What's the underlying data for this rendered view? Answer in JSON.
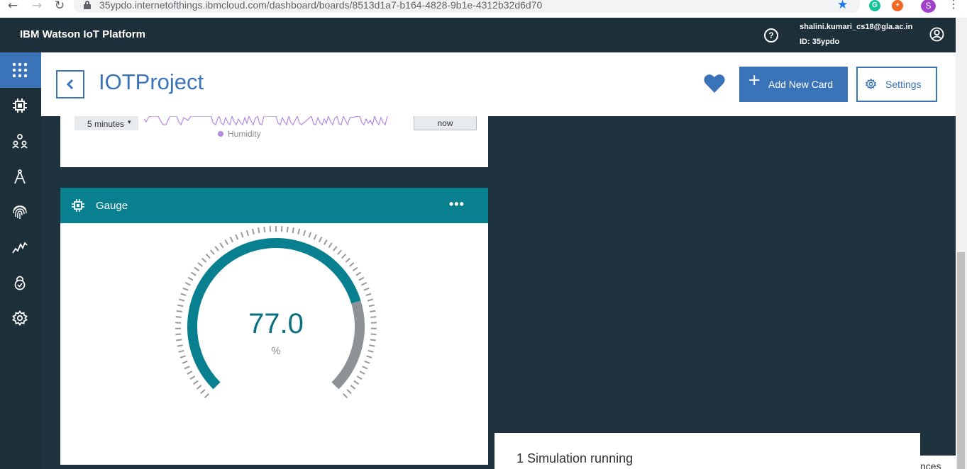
{
  "browser": {
    "url": "35ypdo.internetofthings.ibmcloud.com/dashboard/boards/8513d1a7-b164-4828-9b1e-4312b32d6d70",
    "profile_initial": "S",
    "ext1_initial": "G",
    "ext2_initial": "+"
  },
  "header": {
    "app_title": "IBM Watson IoT Platform",
    "help_symbol": "?",
    "user_email": "shalini.kumari_cs18@gla.ac.in",
    "org_id": "ID: 35ypdo"
  },
  "sidebar": {
    "items": [
      {
        "icon": "apps-grid-icon",
        "active": true
      },
      {
        "icon": "devices-chip-icon",
        "active": false
      },
      {
        "icon": "members-icon",
        "active": false
      },
      {
        "icon": "apps-compass-icon",
        "active": false
      },
      {
        "icon": "fingerprint-icon",
        "active": false
      },
      {
        "icon": "monitoring-icon",
        "active": false
      },
      {
        "icon": "security-lock-icon",
        "active": false
      },
      {
        "icon": "settings-gear-icon",
        "active": false
      }
    ]
  },
  "board": {
    "title": "IOTProject",
    "add_card_label": "Add New Card",
    "settings_label": "Settings"
  },
  "line_card": {
    "range": "5 minutes",
    "now_label": "now",
    "legend": "Humidity",
    "series_color": "#b488e0"
  },
  "gauge_card": {
    "title": "Gauge",
    "value": "77.0",
    "unit": "%",
    "fraction": 0.77,
    "fill_color": "#08808f",
    "rest_color": "#8c9296"
  },
  "simulation": {
    "status": "1 Simulation running",
    "side_text": "nces"
  },
  "colors": {
    "accent": "#3b73b9",
    "header_bg": "#1d2f39",
    "teal": "#08808f"
  }
}
